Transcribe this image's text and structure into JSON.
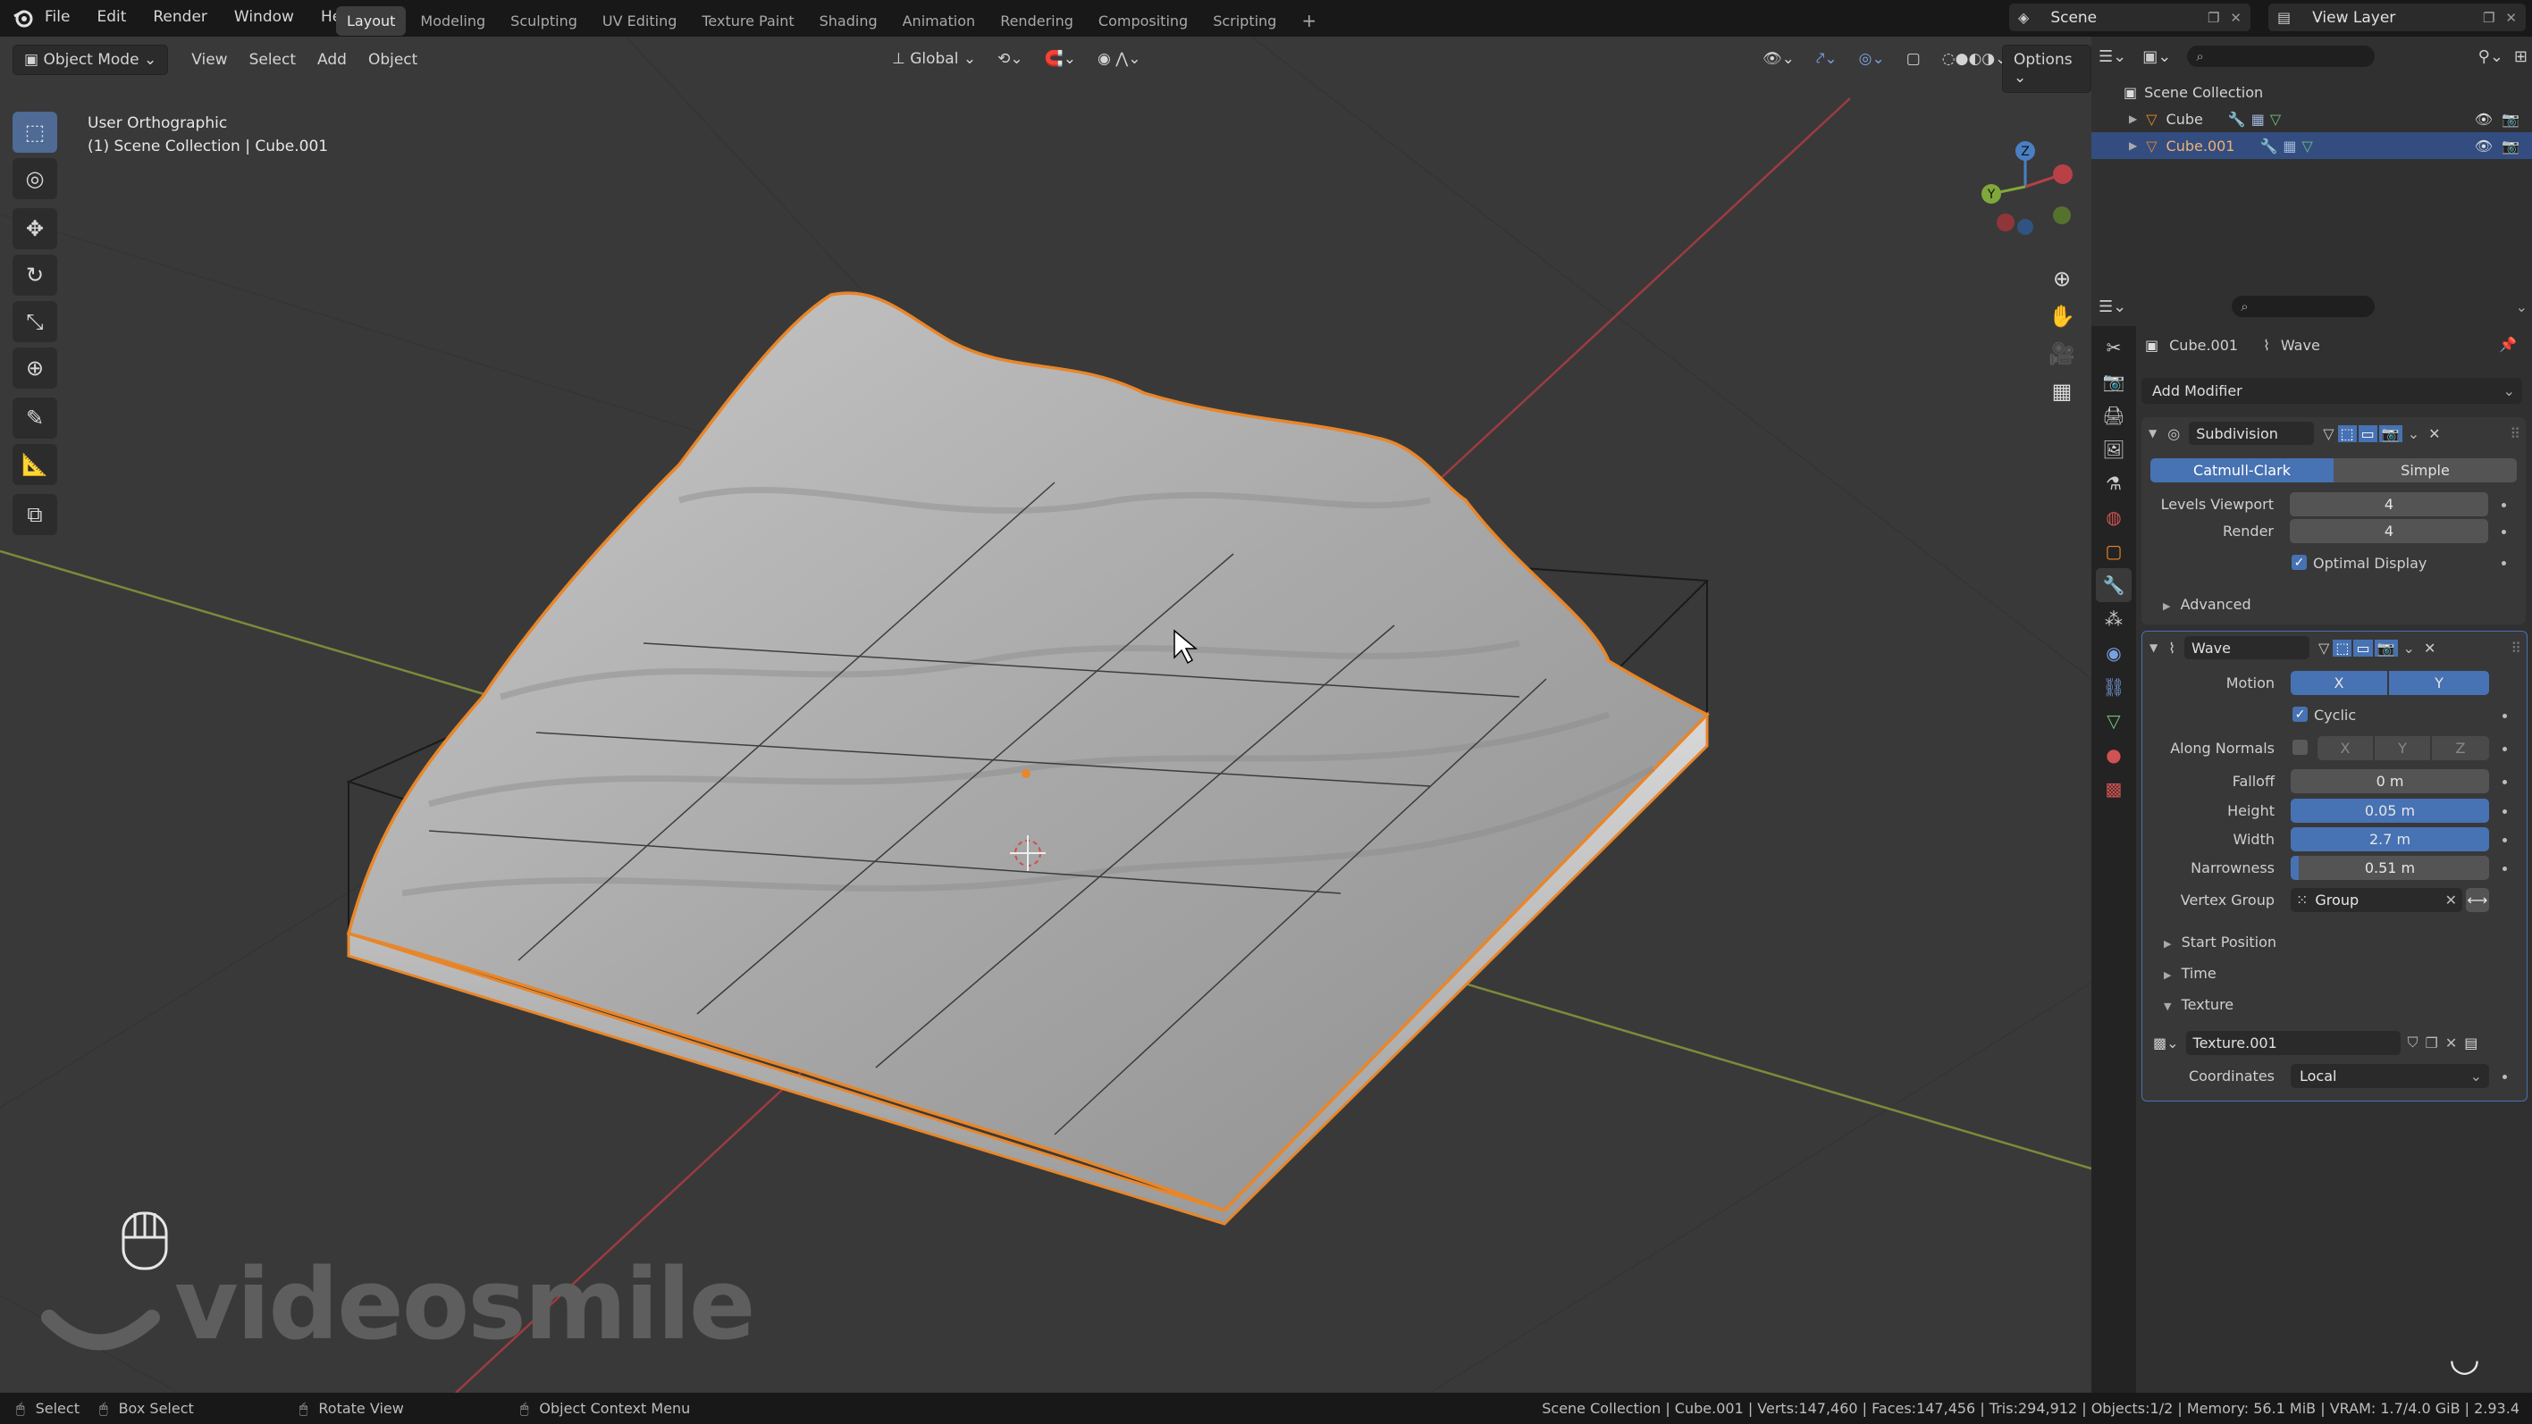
{
  "menu": {
    "items": [
      "File",
      "Edit",
      "Render",
      "Window",
      "Help"
    ]
  },
  "workspaces": {
    "tabs": [
      "Layout",
      "Modeling",
      "Sculpting",
      "UV Editing",
      "Texture Paint",
      "Shading",
      "Animation",
      "Rendering",
      "Compositing",
      "Scripting"
    ],
    "active": "Layout",
    "add": "+"
  },
  "top_right": {
    "scene": "Scene",
    "view_layer": "View Layer"
  },
  "viewport_header": {
    "mode": "Object Mode",
    "menus": [
      "View",
      "Select",
      "Add",
      "Object"
    ],
    "orientation": "Global",
    "options": "Options"
  },
  "viewport": {
    "view_name": "User Orthographic",
    "context": "(1) Scene Collection | Cube.001",
    "gizmo": {
      "z": "Z",
      "y": "Y",
      "x": "X"
    },
    "watermark": "videosmile"
  },
  "outliner": {
    "root": "Scene Collection",
    "items": [
      {
        "name": "Cube",
        "selected": false
      },
      {
        "name": "Cube.001",
        "selected": true
      }
    ]
  },
  "properties": {
    "object_name": "Cube.001",
    "modifier_name": "Wave",
    "add_modifier": "Add Modifier",
    "subdivision": {
      "name": "Subdivision",
      "type_options": [
        "Catmull-Clark",
        "Simple"
      ],
      "active_type": "Catmull-Clark",
      "levels_viewport_label": "Levels Viewport",
      "levels_viewport": "4",
      "render_label": "Render",
      "render": "4",
      "optimal_display_label": "Optimal Display",
      "optimal_display": true,
      "advanced": "Advanced"
    },
    "wave": {
      "name": "Wave",
      "motion_label": "Motion",
      "motion_x": "X",
      "motion_y": "Y",
      "cyclic_label": "Cyclic",
      "cyclic": true,
      "along_normals_label": "Along Normals",
      "along_normals": false,
      "axis_x": "X",
      "axis_y": "Y",
      "axis_z": "Z",
      "falloff_label": "Falloff",
      "falloff": "0 m",
      "height_label": "Height",
      "height": "0.05 m",
      "width_label": "Width",
      "width": "2.7 m",
      "narrowness_label": "Narrowness",
      "narrowness": "0.51 m",
      "vertex_group_label": "Vertex Group",
      "vertex_group": "Group",
      "start_position": "Start Position",
      "time": "Time",
      "texture_section": "Texture",
      "texture_name": "Texture.001",
      "coordinates_label": "Coordinates",
      "coordinates": "Local"
    }
  },
  "status": {
    "select": "Select",
    "box_select": "Box Select",
    "rotate_view": "Rotate View",
    "context_menu": "Object Context Menu",
    "stats": "Scene Collection | Cube.001 | Verts:147,460 | Faces:147,456 | Tris:294,912 | Objects:1/2 | Memory: 56.1 MiB | VRAM: 1.7/4.0 GiB | 2.93.4"
  },
  "colors": {
    "accent": "#4772b3",
    "selection": "#e8862a",
    "x_axis": "#b0373f",
    "y_axis": "#8aa33a"
  }
}
